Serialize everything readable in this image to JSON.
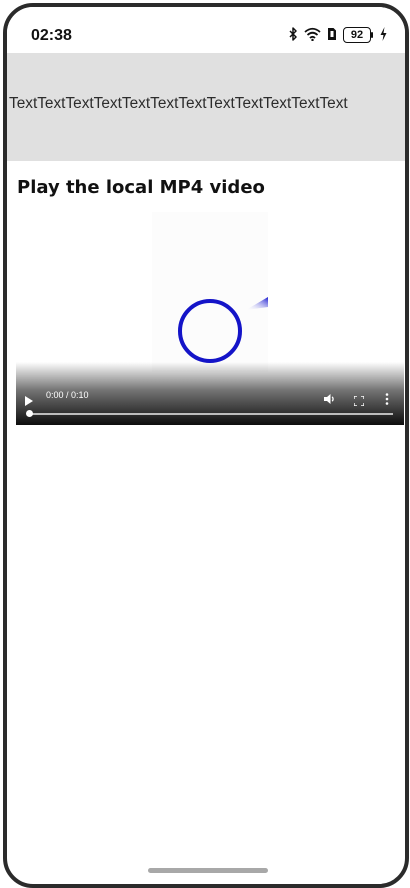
{
  "status_bar": {
    "time": "02:38",
    "battery_level": "92",
    "icons": [
      "bluetooth-icon",
      "wifi-icon",
      "sim-icon",
      "battery-icon",
      "charging-icon"
    ]
  },
  "banner": {
    "text": "TextTextTextTextTextTextTextTextTextTextTextText",
    "background": "#e0e0e0"
  },
  "page": {
    "title": "Play the local MP4 video"
  },
  "video": {
    "time": "0:00 / 0:10",
    "progress": 0,
    "controls": [
      "play-icon",
      "volume-icon",
      "fullscreen-icon",
      "more-vert-icon"
    ],
    "accent": "#1414c8"
  }
}
